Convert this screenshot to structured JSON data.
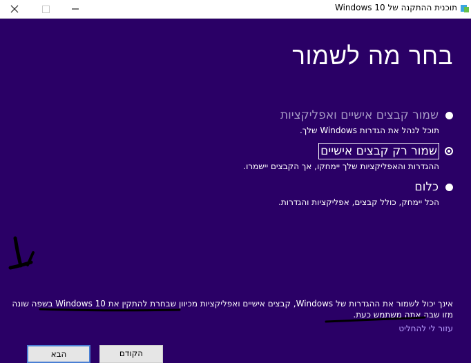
{
  "window": {
    "title": "תוכנית ההתקנה של Windows 10",
    "icons": {
      "close": "close-icon",
      "maximize": "maximize-icon",
      "minimize": "minimize-icon",
      "app": "windows-setup-icon"
    }
  },
  "main": {
    "heading": "בחר מה לשמור",
    "options": [
      {
        "label": "שמור קבצים אישיים ואפליקציות",
        "description": "תוכל לנהל את הגדרות Windows שלך.",
        "state": "disabled"
      },
      {
        "label": "שמור רק קבצים אישיים",
        "description": "ההגדרות והאפליקציות שלך יימחקו, אך הקבצים יישמרו.",
        "state": "selected"
      },
      {
        "label": "כלום",
        "description": "הכל יימחק, כולל קבצים, אפליקציות והגדרות.",
        "state": "enabled"
      }
    ],
    "note": "אינך יכול לשמור את ההגדרות של Windows, קבצים אישיים ואפליקציות מכיוון שבחרת להתקין את Windows 10 בשפה שונה מזו שבה אתה משתמש כעת.",
    "help_link": "עזור לי להחליט"
  },
  "buttons": {
    "next": "הבא",
    "back": "הקודם"
  },
  "colors": {
    "background": "#2a0066",
    "link": "#b89cff",
    "annotation": "#000000"
  }
}
